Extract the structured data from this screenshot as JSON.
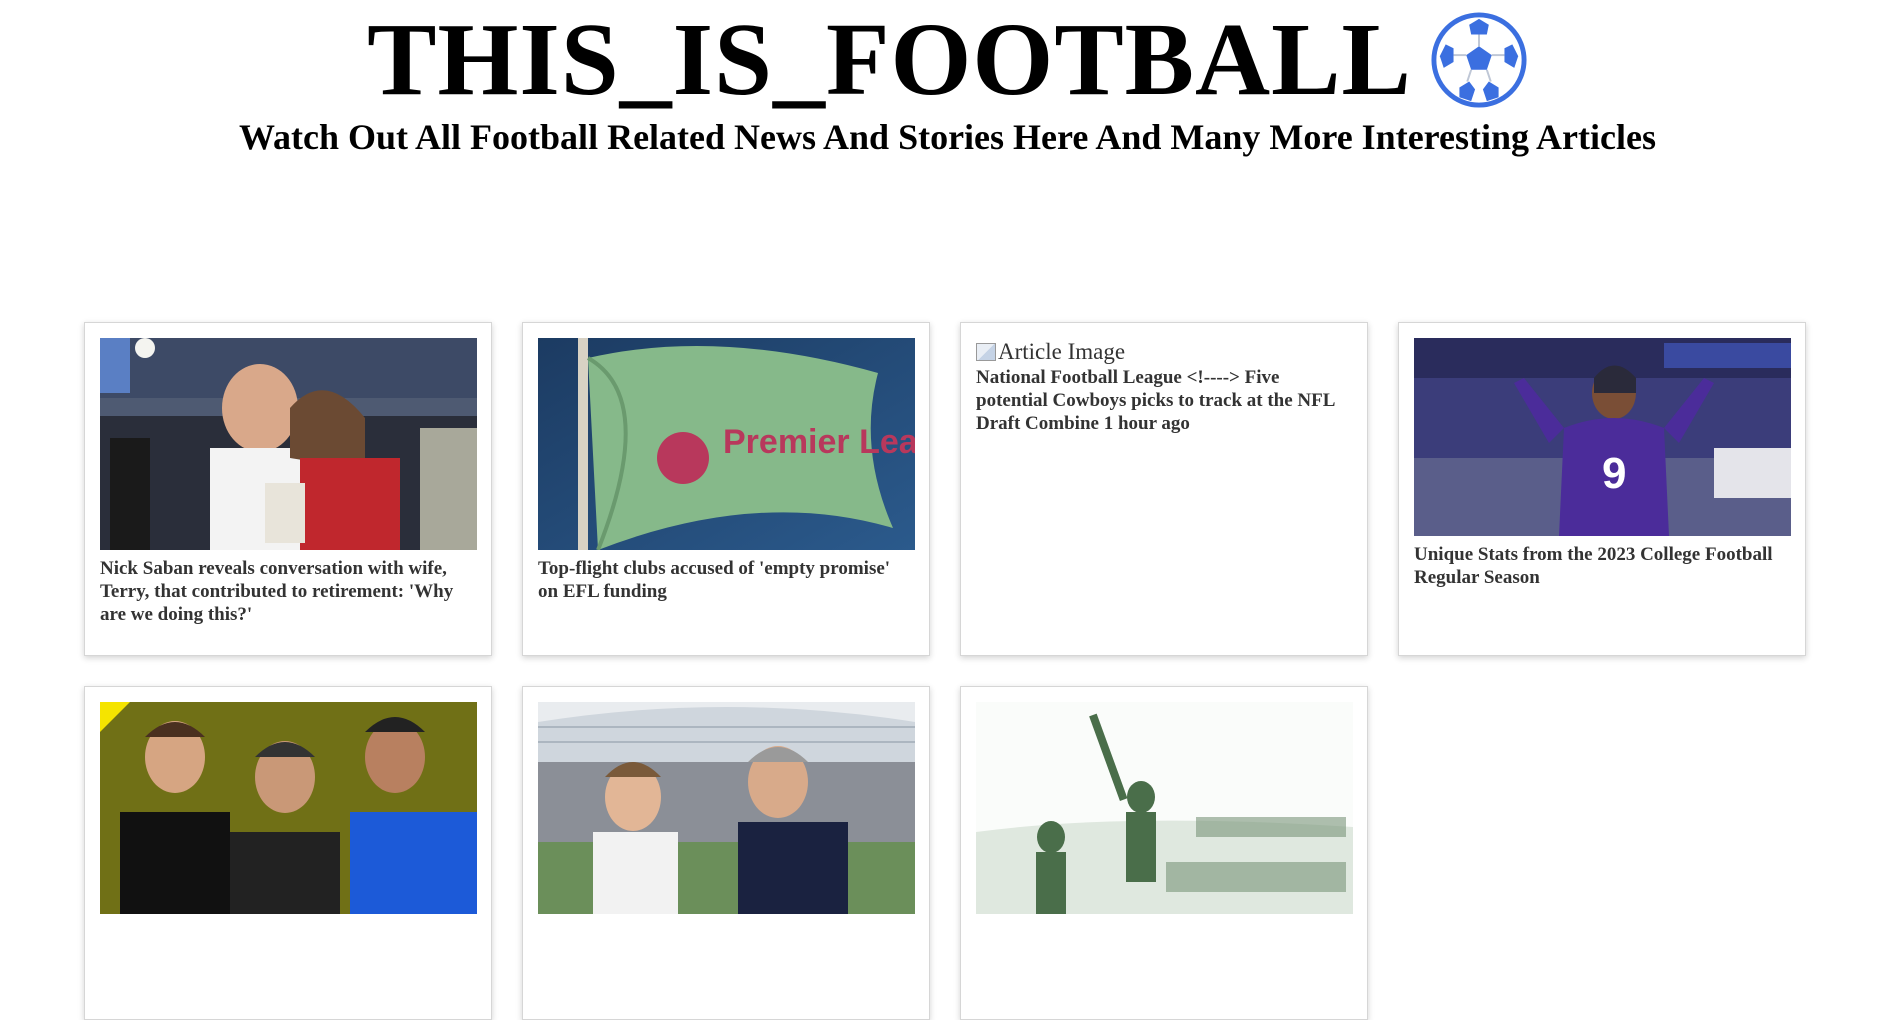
{
  "header": {
    "title": "THIS_IS_FOOTBALL",
    "tagline": "Watch Out All Football Related News And Stories Here And Many More Interesting Articles",
    "logo_icon": "soccer-ball-icon",
    "logo_color": "#3b6fe0"
  },
  "articles": [
    {
      "title": "Nick Saban reveals conversation with wife, Terry, that contributed to retirement: 'Why are we doing this?'",
      "image": "coach-and-wife-photo"
    },
    {
      "title": "Top-flight clubs accused of 'empty promise' on EFL funding",
      "image": "premier-league-flag-photo",
      "image_text": "Premier League"
    },
    {
      "title": "National Football League <!----> Five potential Cowboys picks to track at the NFL Draft Combine 1 hour ago",
      "image": "broken-image",
      "image_alt": "Article Image"
    },
    {
      "title": "Unique Stats from the 2023 College Football Regular Season",
      "image": "quarterback-celebration-photo",
      "image_text": "9"
    },
    {
      "title": "",
      "image": "players-celebrating-photo"
    },
    {
      "title": "",
      "image": "stadium-players-photo"
    },
    {
      "title": "",
      "image": "vintage-cricket-photo"
    }
  ]
}
